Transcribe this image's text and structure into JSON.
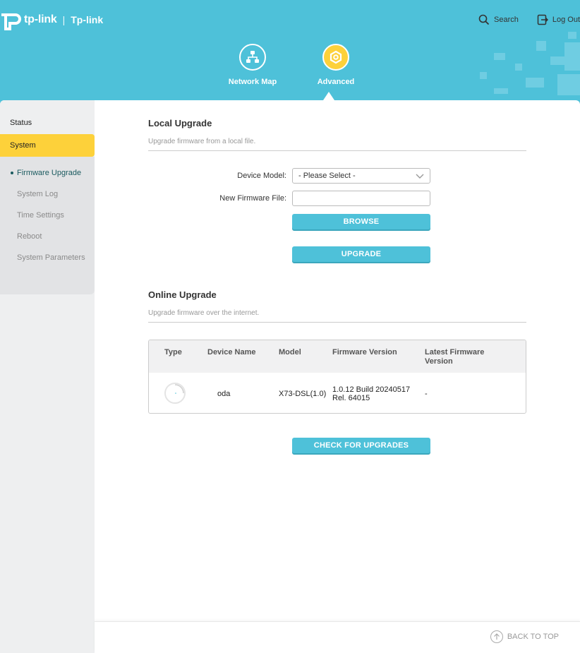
{
  "header": {
    "brand": "tp-link",
    "model_name": "Tp-link",
    "search_label": "Search",
    "logout_label": "Log Out",
    "tabs": [
      {
        "label": "Network Map",
        "icon": "network-map-icon"
      },
      {
        "label": "Advanced",
        "icon": "advanced-gear-icon",
        "active": true
      }
    ]
  },
  "sidebar": {
    "items": [
      {
        "label": "Status"
      },
      {
        "label": "System",
        "active": true
      }
    ],
    "sub_items": [
      {
        "label": "Firmware Upgrade",
        "current": true
      },
      {
        "label": "System Log"
      },
      {
        "label": "Time Settings"
      },
      {
        "label": "Reboot"
      },
      {
        "label": "System Parameters"
      }
    ]
  },
  "local_upgrade": {
    "title": "Local Upgrade",
    "description": "Upgrade firmware from a local file.",
    "device_model_label": "Device Model:",
    "device_model_value": "- Please Select -",
    "firmware_file_label": "New Firmware File:",
    "firmware_file_value": "",
    "browse_label": "BROWSE",
    "upgrade_label": "UPGRADE"
  },
  "online_upgrade": {
    "title": "Online Upgrade",
    "description": "Upgrade firmware over the internet.",
    "columns": [
      "Type",
      "Device Name",
      "Model",
      "Firmware Version",
      "Latest Firmware Version"
    ],
    "rows": [
      {
        "type": "",
        "device_name": "oda",
        "model": "X73-DSL(1.0)",
        "firmware_version": "1.0.12 Build 20240517 Rel. 64015",
        "latest_firmware_version": "-"
      }
    ],
    "check_label": "CHECK FOR UPGRADES"
  },
  "footer": {
    "back_to_top_label": "BACK TO TOP"
  },
  "colors": {
    "brand": "#4ec1d9",
    "accent": "#fdd13a"
  }
}
